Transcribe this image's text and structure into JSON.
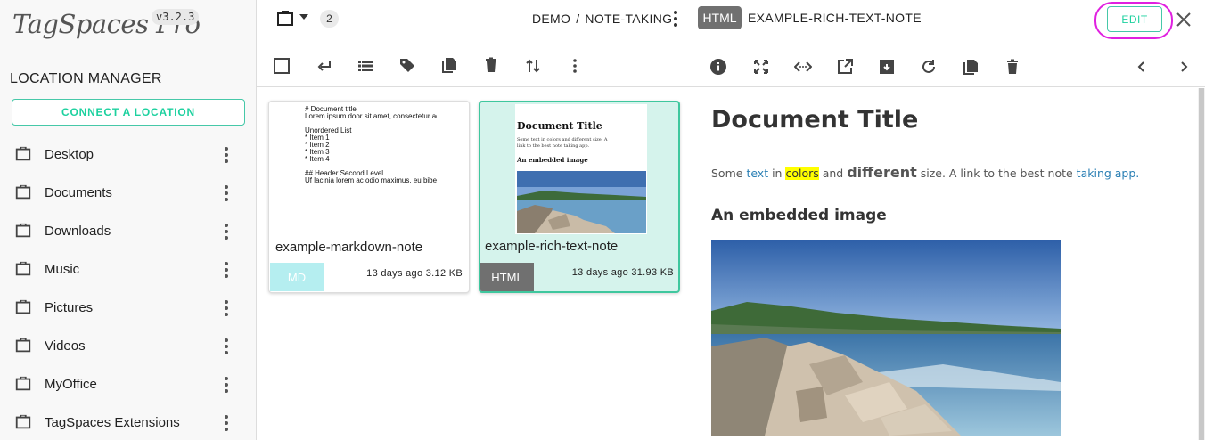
{
  "app": {
    "logo": "TagSpaces Pro",
    "version": "v3.2.3"
  },
  "sidebar": {
    "title": "LOCATION MANAGER",
    "connect_label": "CONNECT A LOCATION",
    "items": [
      {
        "label": "Desktop"
      },
      {
        "label": "Documents"
      },
      {
        "label": "Downloads"
      },
      {
        "label": "Music"
      },
      {
        "label": "Pictures"
      },
      {
        "label": "Videos"
      },
      {
        "label": "MyOffice"
      },
      {
        "label": "TagSpaces Extensions"
      }
    ]
  },
  "middle": {
    "count": "2",
    "breadcrumb": [
      "DEMO",
      "/",
      "NOTE-TAKING"
    ],
    "cards": [
      {
        "name": "example-markdown-note",
        "tag": "MD",
        "meta": "13 days ago 3.12 KB",
        "preview": "# Document title\nLorem ipsum door sit amet, consectetur adip\n\nUnordered List\n* Item 1\n* Item 2\n* Item 3\n* Item 4\n\n## Header Second Level\nUf lacinia lorem ac odio maximus, eu bibendu"
      },
      {
        "name": "example-rich-text-note",
        "tag": "HTML",
        "meta": "13 days ago 31.93 KB",
        "preview_title": "Document Title",
        "preview_line1": "Some text in colors and different size. A",
        "preview_line2": "link to the best note taking app.",
        "preview_h2": "An embedded image"
      }
    ]
  },
  "right": {
    "badge": "HTML",
    "title": "EXAMPLE-RICH-TEXT-NOTE",
    "edit_label": "EDIT",
    "doc": {
      "title": "Document Title",
      "para": {
        "t1": "Some ",
        "t2": "text",
        "t3": " in ",
        "t4": "colors",
        "t5": " and ",
        "t6": "different",
        "t7": " size. A link to the best note ",
        "t8": "taking app."
      },
      "h2": "An embedded image"
    }
  },
  "colors": {
    "accent": "#1dd19f",
    "highlight_ring": "#e020e0",
    "selected_bg": "#d5f3ec",
    "md_tag": "#b5eef0",
    "html_tag": "#707070"
  }
}
